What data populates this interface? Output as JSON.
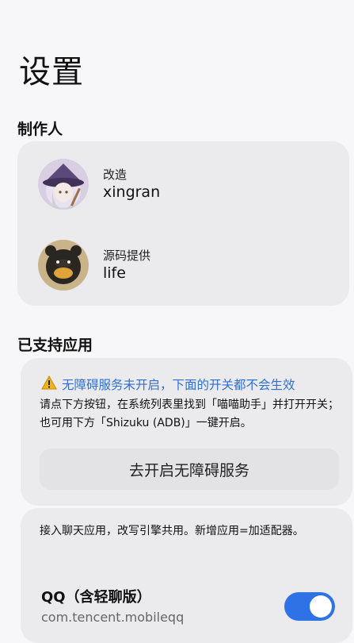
{
  "page": {
    "title": "设置"
  },
  "creators": {
    "section_title": "制作人",
    "items": [
      {
        "role": "改造",
        "name": "xingran"
      },
      {
        "role": "源码提供",
        "name": "life"
      }
    ]
  },
  "supported_apps": {
    "section_title": "已支持应用",
    "warning": {
      "title": "无障碍服务未开启，下面的开关都不会生效",
      "body": "请点下方按钮，在系统列表里找到「喵喵助手」并打开开关；也可用下方「Shizuku (ADB)」一键开启。",
      "button_label": "去开启无障碍服务"
    },
    "description": "接入聊天应用，改写引擎共用。新增应用=加适配器。",
    "apps": [
      {
        "name": "QQ（含轻聊版）",
        "package": "com.tencent.mobileqq",
        "enabled": true
      }
    ]
  },
  "colors": {
    "accent": "#2e72e6",
    "warning_text": "#2f6fd6",
    "card_bg": "#ebebee",
    "page_bg": "#f7f7f9"
  }
}
